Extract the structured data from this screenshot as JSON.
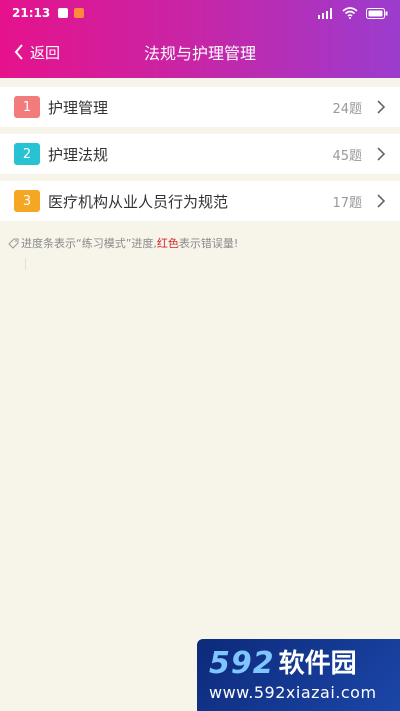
{
  "status": {
    "time": "21:13"
  },
  "nav": {
    "back_label": "返回",
    "title": "法规与护理管理"
  },
  "items": [
    {
      "index": "1",
      "label": "护理管理",
      "count": "24题",
      "color": "#f27c7c"
    },
    {
      "index": "2",
      "label": "护理法规",
      "count": "45题",
      "color": "#27c2d3"
    },
    {
      "index": "3",
      "label": "医疗机构从业人员行为规范",
      "count": "17题",
      "color": "#f5a623"
    }
  ],
  "hint": {
    "part1": "进度条表示“练习模式”进度,",
    "red": "红色",
    "part2": "表示错误量!"
  },
  "watermark": {
    "brand_num": "592",
    "brand_cn": "软件园",
    "url": "www.592xiazai.com"
  }
}
